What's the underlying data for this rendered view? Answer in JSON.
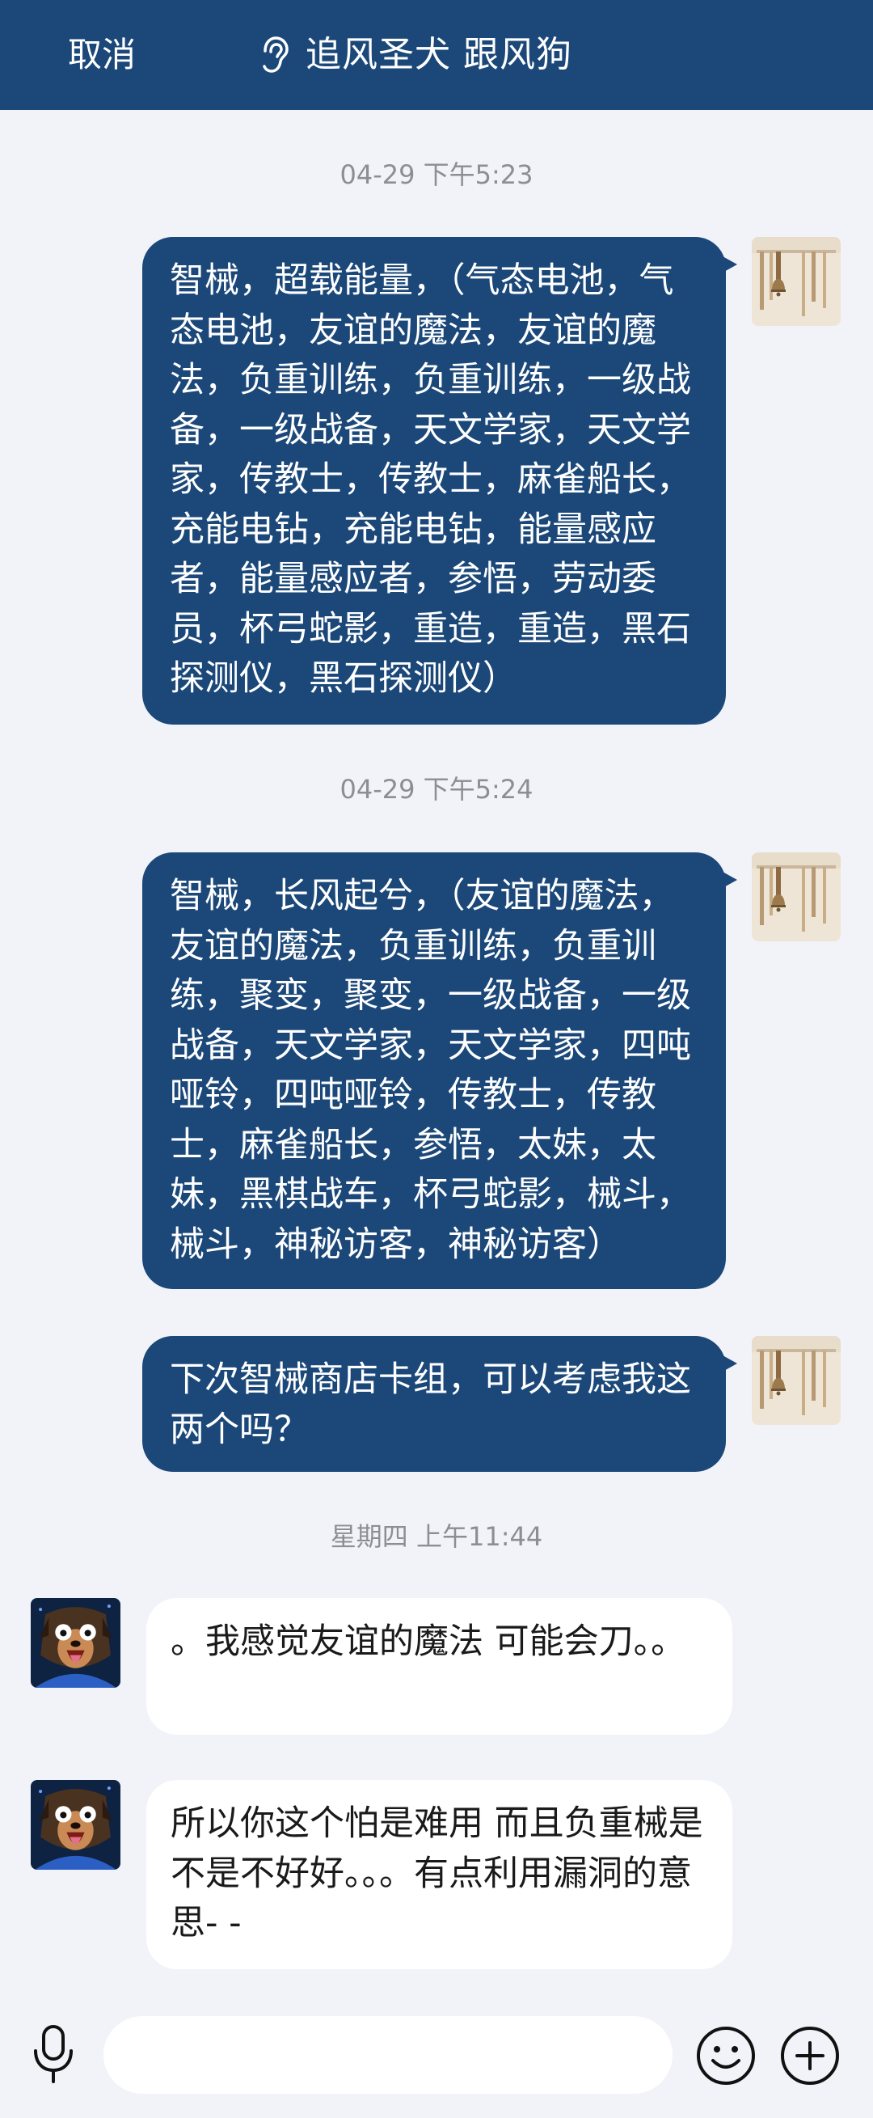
{
  "header": {
    "cancel_label": "取消",
    "title": "追风圣犬 跟风狗",
    "icon": "hearing-ear-icon",
    "background": "#1b4879"
  },
  "messages": [
    {
      "type": "timestamp",
      "text": "04-29 下午5:23"
    },
    {
      "type": "outgoing",
      "text": "智械，超载能量，（气态电池，气态电池，友谊的魔法，友谊的魔法，负重训练，负重训练，一级战备，一级战备，天文学家，天文学家，传教士，传教士，麻雀船长，充能电钻，充能电钻，能量感应者，能量感应者，参悟，劳动委员，杯弓蛇影，重造，重造，黑石探测仪，黑石探测仪）"
    },
    {
      "type": "timestamp",
      "text": "04-29 下午5:24"
    },
    {
      "type": "outgoing",
      "text": "智械，长风起兮，（友谊的魔法，友谊的魔法，负重训练，负重训练，聚变，聚变，一级战备，一级战备，天文学家，天文学家，四吨哑铃，四吨哑铃，传教士，传教士，麻雀船长，参悟，太妹，太妹，黑棋战车，杯弓蛇影，械斗，械斗，神秘访客，神秘访客）"
    },
    {
      "type": "outgoing",
      "text": "下次智械商店卡组，可以考虑我这两个吗？"
    },
    {
      "type": "timestamp",
      "text": "星期四 上午11:44"
    },
    {
      "type": "incoming",
      "text": "。我感觉友谊的魔法 可能会刀。。"
    },
    {
      "type": "incoming",
      "text": "所以你这个怕是难用 而且负重械是不是不好好。。。有点利用漏洞的意思- -"
    }
  ],
  "composer": {
    "placeholder": "",
    "mic_icon": "microphone-icon",
    "emoji_icon": "emoji-icon",
    "plus_icon": "plus-icon"
  },
  "colors": {
    "accent": "#1b4879",
    "background": "#f2f3f8",
    "incoming_bubble": "#ffffff",
    "timestamp_text": "#8d8d95"
  }
}
